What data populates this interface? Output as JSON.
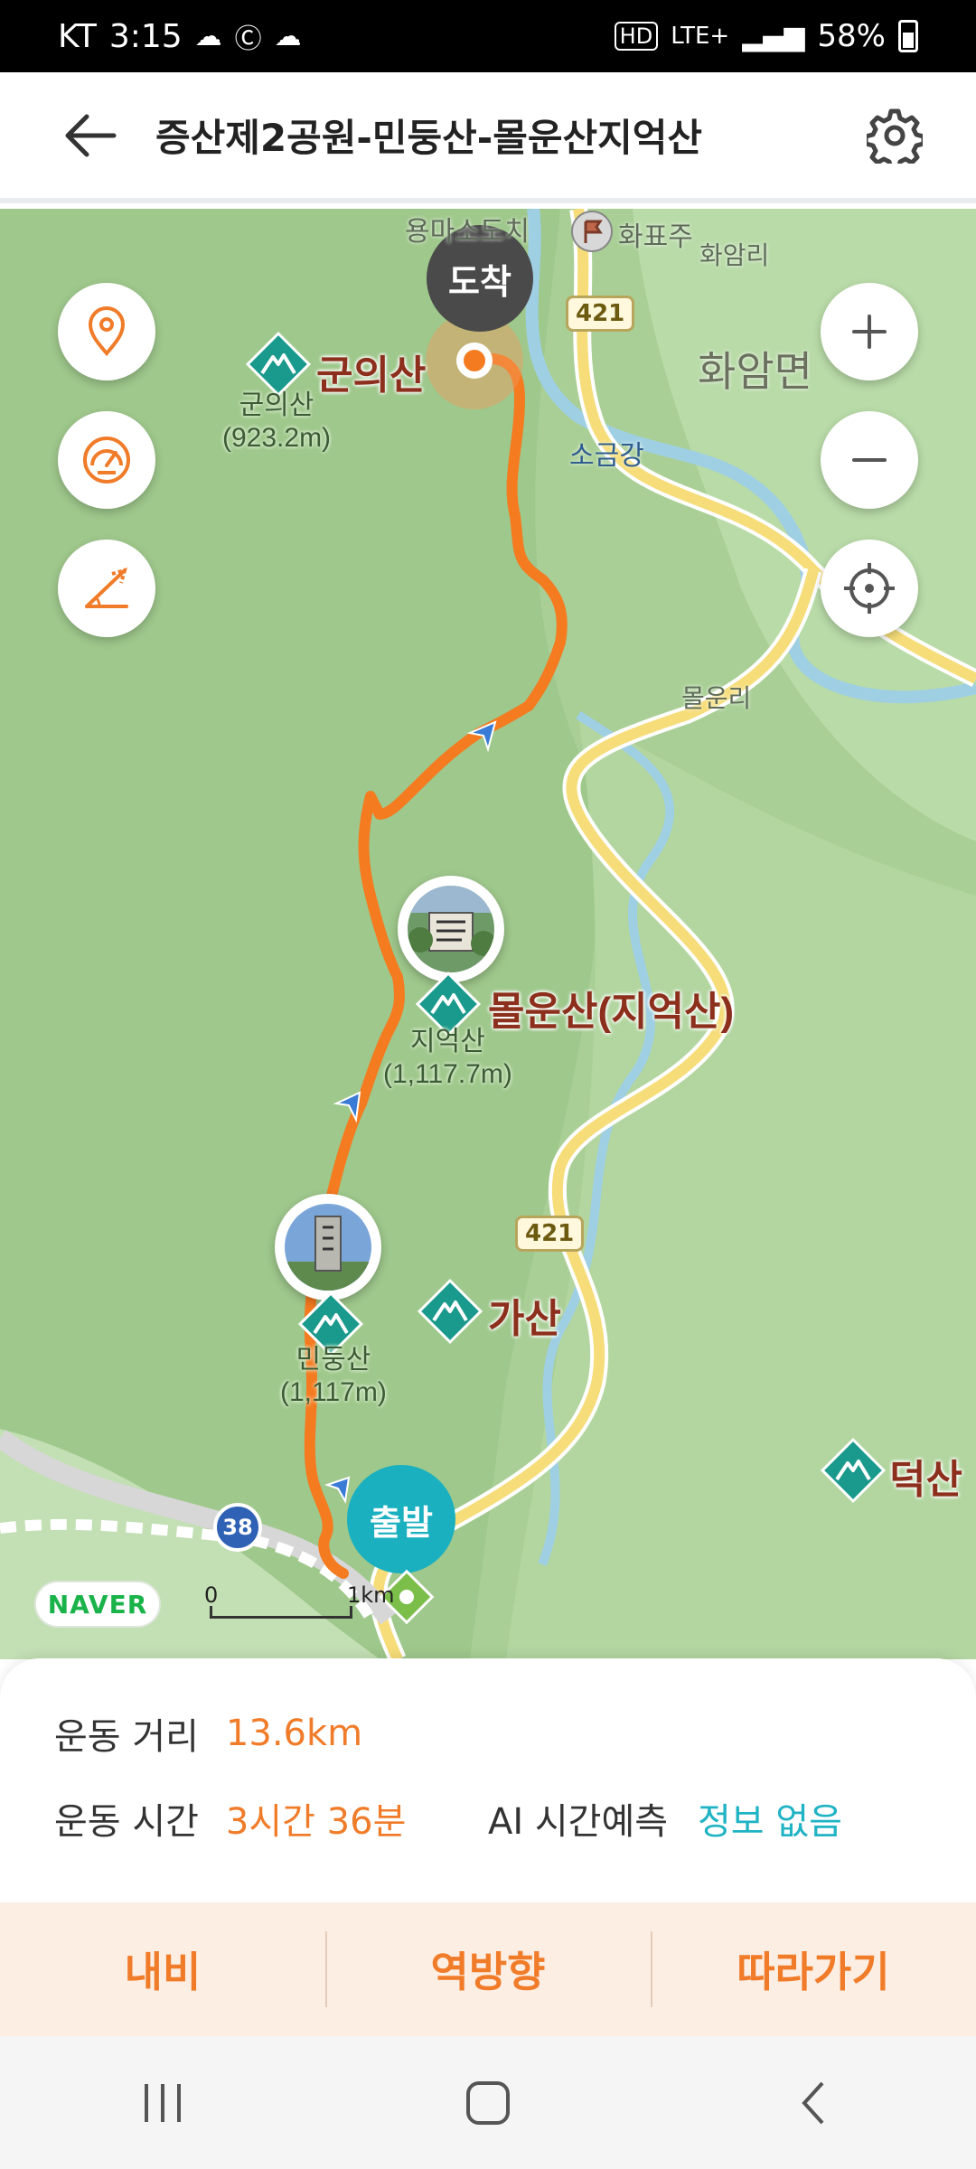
{
  "status_bar": {
    "carrier": "KT",
    "time": "3:15",
    "network": "LTE+",
    "battery": "58%"
  },
  "header": {
    "title": "증산제2공원-민둥산-몰운산지억산"
  },
  "map": {
    "peaks": [
      {
        "name": "군의산",
        "sub_name": "군의산",
        "elevation": "(923.2m)"
      },
      {
        "name": "몰운산(지억산)",
        "sub_name": "지억산",
        "elevation": "(1,117.7m)"
      },
      {
        "name": "가산"
      },
      {
        "name": "덕산"
      },
      {
        "sub_name": "민둥산",
        "elevation": "(1,117m)"
      }
    ],
    "places": {
      "yongma": "용마소도치",
      "hwapyoju": "화표주",
      "hwaamri": "화암리",
      "hwaammyeon": "화암면",
      "sogeumgang": "소금강",
      "molunri": "몰운리"
    },
    "road_421": "421",
    "route_38": "38",
    "arrival_label": "도착",
    "start_label": "출발",
    "naver": "NAVER",
    "scale_zero": "0",
    "scale_one": "1km",
    "colors": {
      "route": "#f47b20",
      "map_bg": "#a9cf96",
      "peak_icon": "#1a9a8c",
      "start": "#1ab0c0"
    }
  },
  "info": {
    "distance_label": "운동 거리",
    "distance_value": "13.6km",
    "time_label": "운동 시간",
    "time_value": "3시간 36분",
    "ai_label": "AI 시간예측",
    "ai_value": "정보 없음"
  },
  "actions": {
    "navi": "내비",
    "reverse": "역방향",
    "follow": "따라가기"
  }
}
